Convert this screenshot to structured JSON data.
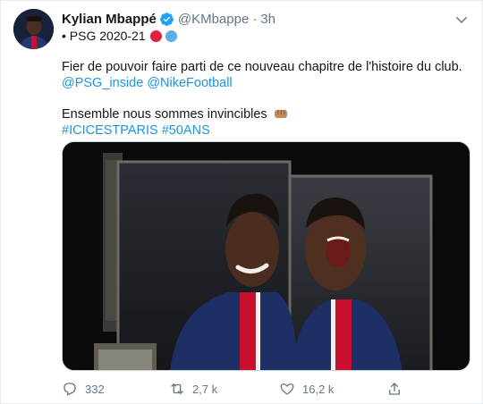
{
  "author": {
    "name": "Kylian Mbappé",
    "handle": "@KMbappe",
    "separator": "·",
    "time": "3h",
    "subline": "• PSG 2020-21",
    "subline_colors": [
      "#e0203c",
      "#5aaee8"
    ]
  },
  "tweet": {
    "line1": "Fier de pouvoir faire parti de ce nouveau chapitre de l'histoire du club.",
    "mention1": "@PSG_inside",
    "mention2": "@NikeFootball",
    "line3": "Ensemble nous sommes invincibles",
    "hashtag1": "#ICICESTPARIS",
    "hashtag2": "#50ANS"
  },
  "stats": {
    "replies": "332",
    "retweets": "2,7 k",
    "likes": "16,2 k"
  },
  "icons": {
    "verified": "verified-badge-icon",
    "caret": "chevron-down-icon",
    "reply": "reply-icon",
    "retweet": "retweet-icon",
    "like": "heart-icon",
    "share": "share-icon"
  },
  "colors": {
    "accent": "#1b95e0",
    "muted": "#657786",
    "verified": "#1da1f2"
  }
}
